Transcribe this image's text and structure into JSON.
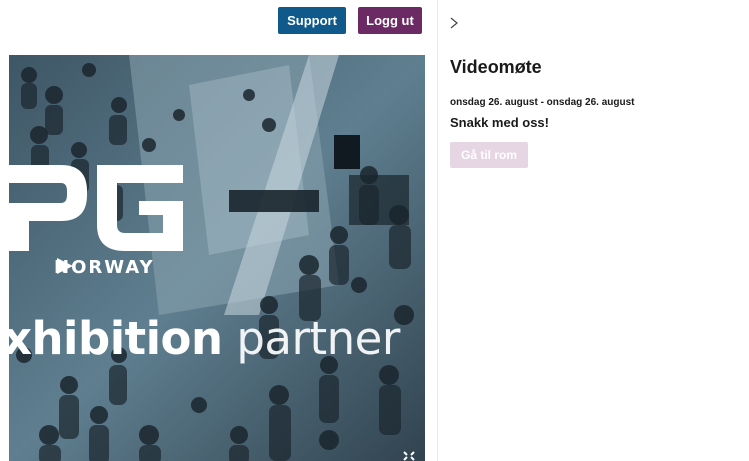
{
  "header": {
    "support_label": "Support",
    "logout_label": "Logg ut"
  },
  "video": {
    "logo_sub": "NORWAY",
    "tagline_bold": "xhibition",
    "tagline_light": "partner",
    "icons": [
      "play-icon",
      "fullscreen-icon"
    ]
  },
  "side_panel": {
    "nav_icon": "chevron-right-icon",
    "title": "Videomøte",
    "dates": "onsdag 26. august - onsdag 26. august",
    "description": "Snakk med oss!",
    "room_button_label": "Gå til rom"
  },
  "colors": {
    "support_button": "#0f5a8a",
    "logout_button": "#6c2a64",
    "room_button_disabled": "#e6d5e3",
    "text_dark": "#1a1a1a"
  }
}
